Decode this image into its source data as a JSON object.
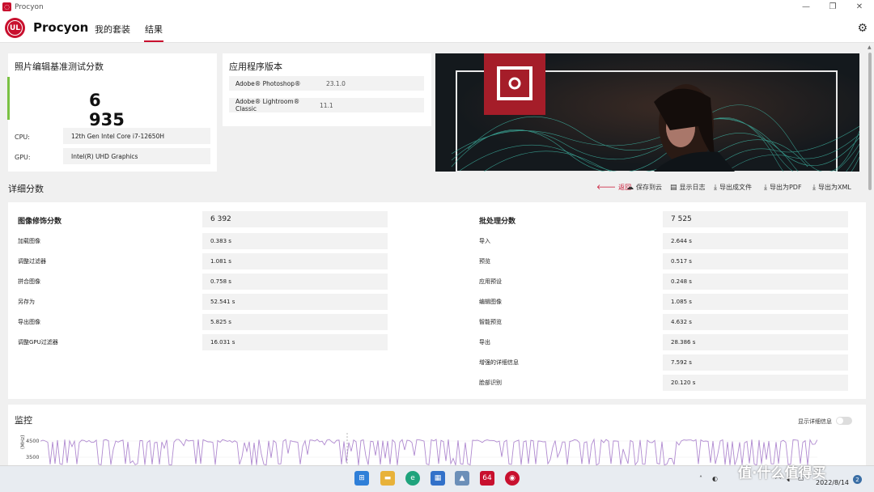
{
  "window": {
    "title": "Procyon"
  },
  "header": {
    "brand": "Procyon",
    "nav": [
      "我的套装",
      "结果"
    ],
    "active_tab": "结果"
  },
  "score_card": {
    "title": "照片编辑基准测试分数",
    "score": "6 935",
    "cpu_label": "CPU:",
    "cpu_value": "12th Gen Intel Core i7-12650H",
    "gpu_label": "GPU:",
    "gpu_value": "Intel(R) UHD Graphics"
  },
  "apps": {
    "title": "应用程序版本",
    "rows": [
      {
        "name": "Adobe® Photoshop®",
        "version": "23.1.0"
      },
      {
        "name": "Adobe® Lightroom® Classic",
        "version": "11.1"
      }
    ]
  },
  "details": {
    "title": "详细分数",
    "actions": [
      "返回",
      "保存到云",
      "显示日志",
      "导出成文件",
      "导出为PDF",
      "导出为XML"
    ],
    "left": {
      "header": {
        "label": "图像修饰分数",
        "value": "6 392"
      },
      "rows": [
        {
          "label": "加载图像",
          "value": "0.383 s"
        },
        {
          "label": "调整过滤器",
          "value": "1.081 s"
        },
        {
          "label": "拼合图像",
          "value": "0.758 s"
        },
        {
          "label": "另存为",
          "value": "52.541 s"
        },
        {
          "label": "导出图像",
          "value": "5.825 s"
        },
        {
          "label": "调整GPU过滤器",
          "value": "16.031 s"
        }
      ]
    },
    "right": {
      "header": {
        "label": "批处理分数",
        "value": "7 525"
      },
      "rows": [
        {
          "label": "导入",
          "value": "2.644 s"
        },
        {
          "label": "预览",
          "value": "0.517 s"
        },
        {
          "label": "应用预设",
          "value": "0.248 s"
        },
        {
          "label": "编辑图像",
          "value": "1.085 s"
        },
        {
          "label": "智能预览",
          "value": "4.632 s"
        },
        {
          "label": "导出",
          "value": "28.386 s"
        },
        {
          "label": "增强的详细信息",
          "value": "7.592 s"
        },
        {
          "label": "脸部识别",
          "value": "20.120 s"
        }
      ]
    }
  },
  "monitor": {
    "title": "监控",
    "toggle_label": "显示详细信息",
    "toggle_on": false,
    "y_ticks": [
      "4500",
      "3500"
    ],
    "y_label": "(MHz)",
    "line_color": "#b08ad0"
  },
  "taskbar": {
    "icons": [
      "start-icon",
      "file-explorer-icon",
      "edge-icon",
      "store-icon",
      "photos-icon",
      "aida64-icon",
      "procyon-icon"
    ],
    "aida_label": "64",
    "date": "2022/8/14",
    "notifications": "2"
  },
  "watermark": "值·什么值得买",
  "colors": {
    "accent_red": "#c8102e",
    "accent_green": "#7ac143"
  }
}
